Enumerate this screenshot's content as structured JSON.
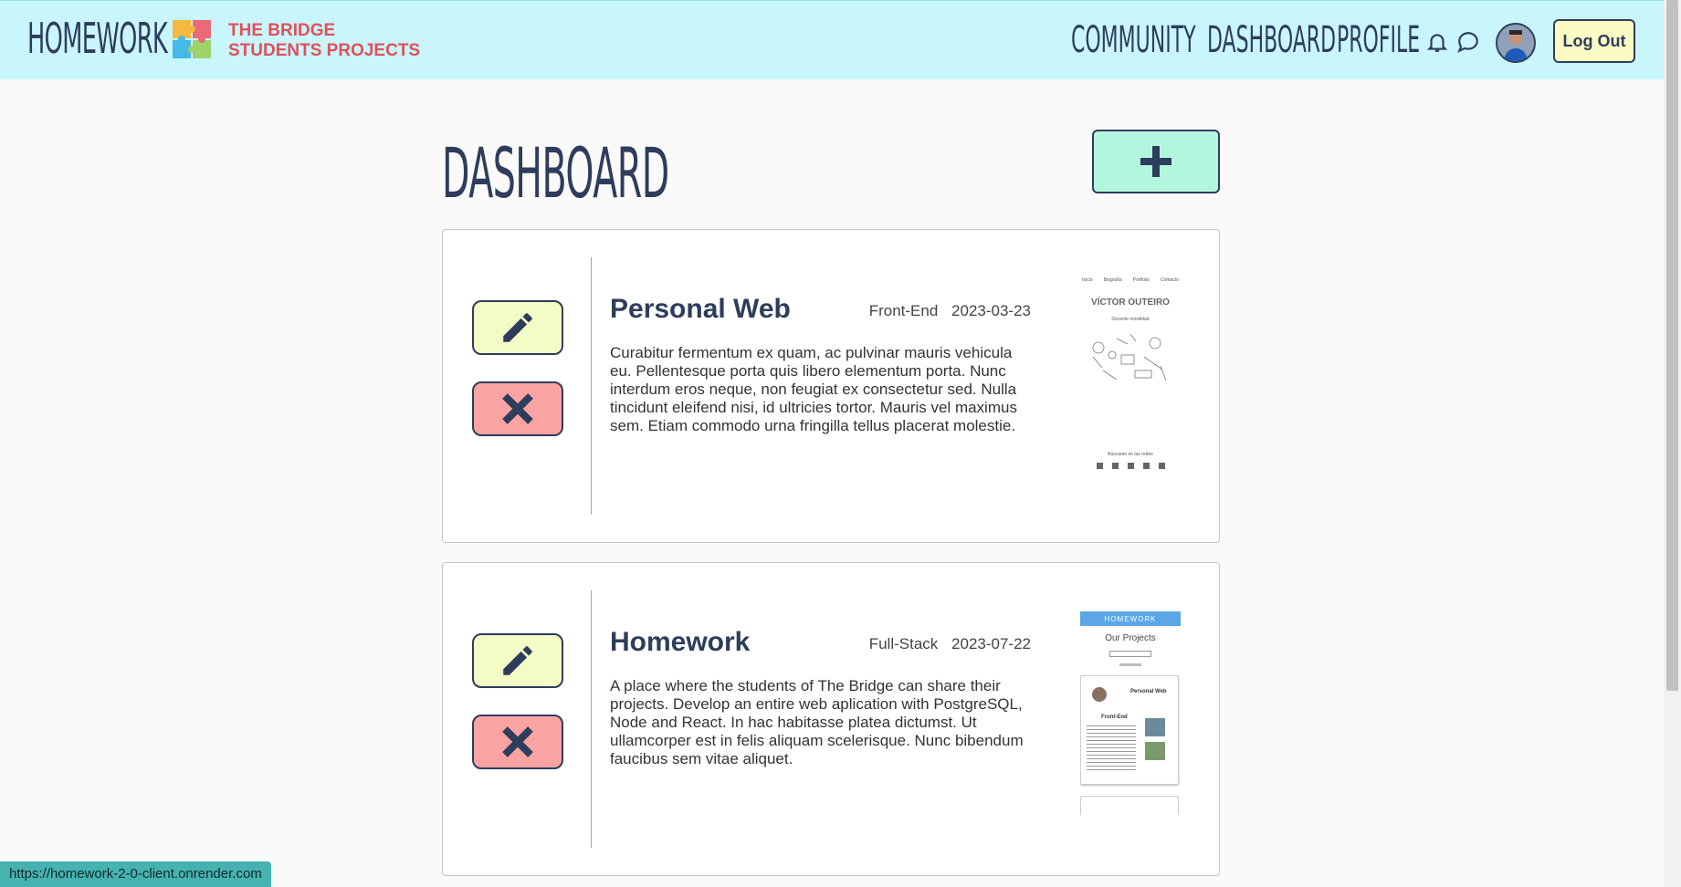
{
  "header": {
    "logo_text": "HOMEWORK",
    "brand_line1": "THE BRIDGE",
    "brand_line2": "STUDENTS PROJECTS",
    "nav": [
      "COMMUNITY",
      "DASHBOARD",
      "PROFILE"
    ],
    "logout_label": "Log Out"
  },
  "main": {
    "title": "DASHBOARD",
    "projects": [
      {
        "title": "Personal Web",
        "category": "Front-End",
        "date": "2023-03-23",
        "description": "Curabitur fermentum ex quam, ac pulvinar mauris vehicula eu. Pellentesque porta quis libero elementum porta. Nunc interdum eros neque, non feugiat ex consectetur sed. Nulla tincidunt eleifend nisi, id ultricies tortor. Mauris vel maximus sem. Etiam commodo urna fringilla tellus placerat molestie.",
        "thumb": {
          "nav": [
            "Inicio",
            "Biografía",
            "Portfolio",
            "Contacto"
          ],
          "name": "VÍCTOR OUTEIRO",
          "subtitle": "Docente movilidad",
          "footer": "Búscame en las redes"
        }
      },
      {
        "title": "Homework",
        "category": "Full-Stack",
        "date": "2023-07-22",
        "description": "A place where the students of The Bridge can share their projects. Develop an entire web aplication with PostgreSQL, Node and React. In hac habitasse platea dictumst. Ut ullamcorper est in felis aliquam scelerisque. Nunc bibendum faucibus sem vitae aliquet.",
        "thumb": {
          "header": "HOMEWORK",
          "heading": "Our Projects",
          "card_title": "Personal Web",
          "card_tag": "Front-End"
        }
      }
    ]
  },
  "status_bar": {
    "url": "https://homework-2-0-client.onrender.com"
  },
  "colors": {
    "header_bg": "#c9f6fd",
    "brand": "#e0505a",
    "primary_text": "#2e3d5c",
    "add_button": "#b2f7dd",
    "edit_button": "#f4fcc6",
    "delete_button": "#f9a3a3",
    "logout_button": "#fdfbc4"
  }
}
